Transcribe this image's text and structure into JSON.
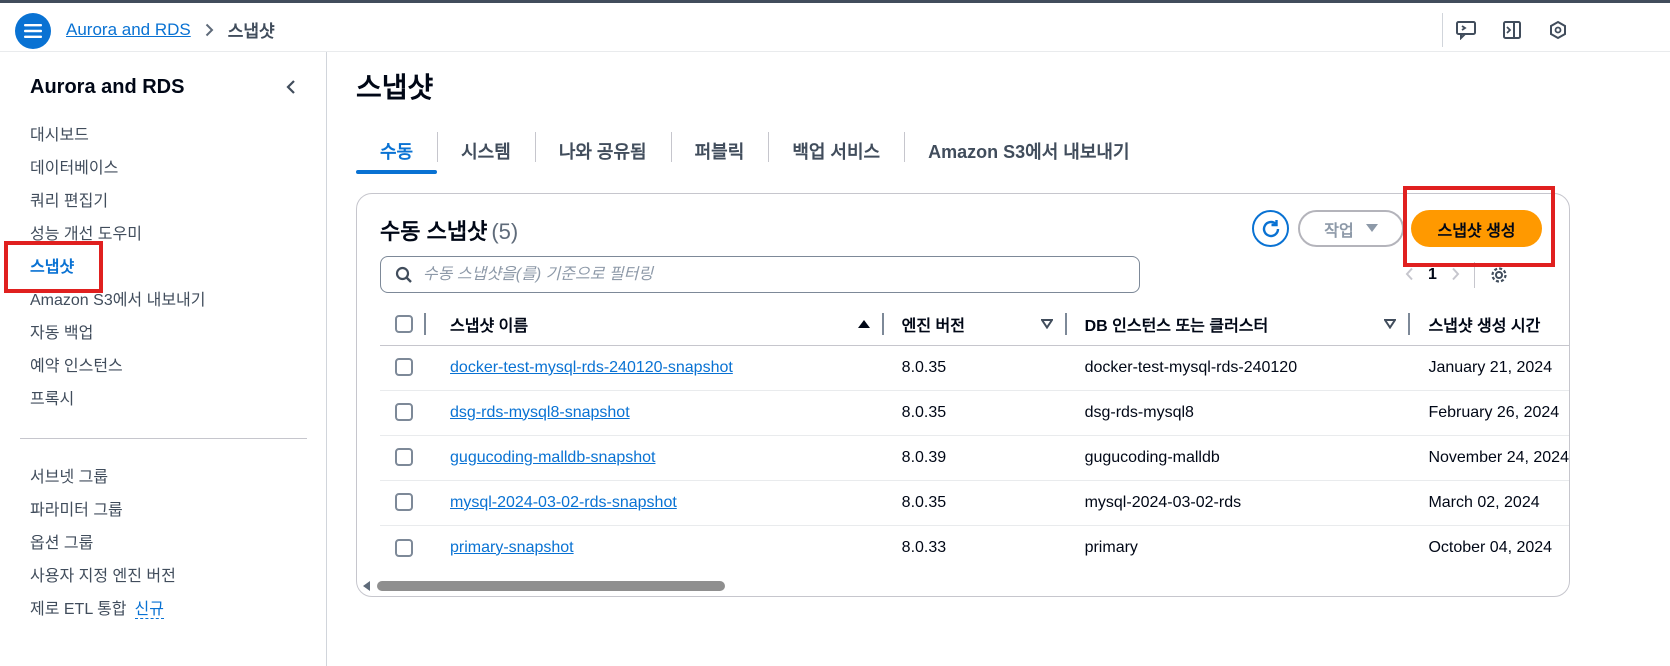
{
  "breadcrumb": {
    "parent": "Aurora and RDS",
    "current": "스냅샷"
  },
  "sidebar": {
    "title": "Aurora and RDS",
    "items": [
      {
        "label": "대시보드"
      },
      {
        "label": "데이터베이스"
      },
      {
        "label": "쿼리 편집기"
      },
      {
        "label": "성능 개선 도우미"
      },
      {
        "label": "스냅샷",
        "active": true
      },
      {
        "label": "Amazon S3에서 내보내기"
      },
      {
        "label": "자동 백업"
      },
      {
        "label": "예약 인스턴스"
      },
      {
        "label": "프록시"
      }
    ],
    "items2": [
      {
        "label": "서브넷 그룹"
      },
      {
        "label": "파라미터 그룹"
      },
      {
        "label": "옵션 그룹"
      },
      {
        "label": "사용자 지정 엔진 버전"
      },
      {
        "label": "제로 ETL 통합",
        "badge": "신규"
      }
    ]
  },
  "page": {
    "title": "스냅샷"
  },
  "tabs": [
    {
      "label": "수동",
      "active": true
    },
    {
      "label": "시스템"
    },
    {
      "label": "나와 공유됨"
    },
    {
      "label": "퍼블릭"
    },
    {
      "label": "백업 서비스"
    },
    {
      "label": "Amazon S3에서 내보내기"
    }
  ],
  "container": {
    "title": "수동 스냅샷",
    "count": "(5)",
    "actions_label": "작업",
    "create_label": "스냅샷 생성",
    "search_placeholder": "수동 스냅샷을(를) 기준으로 필터링",
    "page_number": "1"
  },
  "table": {
    "columns": [
      "스냅샷 이름",
      "엔진 버전",
      "DB 인스턴스 또는 클러스터",
      "스냅샷 생성 시간"
    ],
    "rows": [
      {
        "name": "docker-test-mysql-rds-240120-snapshot",
        "version": "8.0.35",
        "db": "docker-test-mysql-rds-240120",
        "time": "January 21, 2024"
      },
      {
        "name": "dsg-rds-mysql8-snapshot",
        "version": "8.0.35",
        "db": "dsg-rds-mysql8",
        "time": "February 26, 2024"
      },
      {
        "name": "gugucoding-malldb-snapshot",
        "version": "8.0.39",
        "db": "gugucoding-malldb",
        "time": "November 24, 2024"
      },
      {
        "name": "mysql-2024-03-02-rds-snapshot",
        "version": "8.0.35",
        "db": "mysql-2024-03-02-rds",
        "time": "March 02, 2024"
      },
      {
        "name": "primary-snapshot",
        "version": "8.0.33",
        "db": "primary",
        "time": "October 04, 2024"
      }
    ]
  },
  "colors": {
    "accent": "#0972d3",
    "primary_button": "#ff9900",
    "highlight": "#e0201f"
  }
}
